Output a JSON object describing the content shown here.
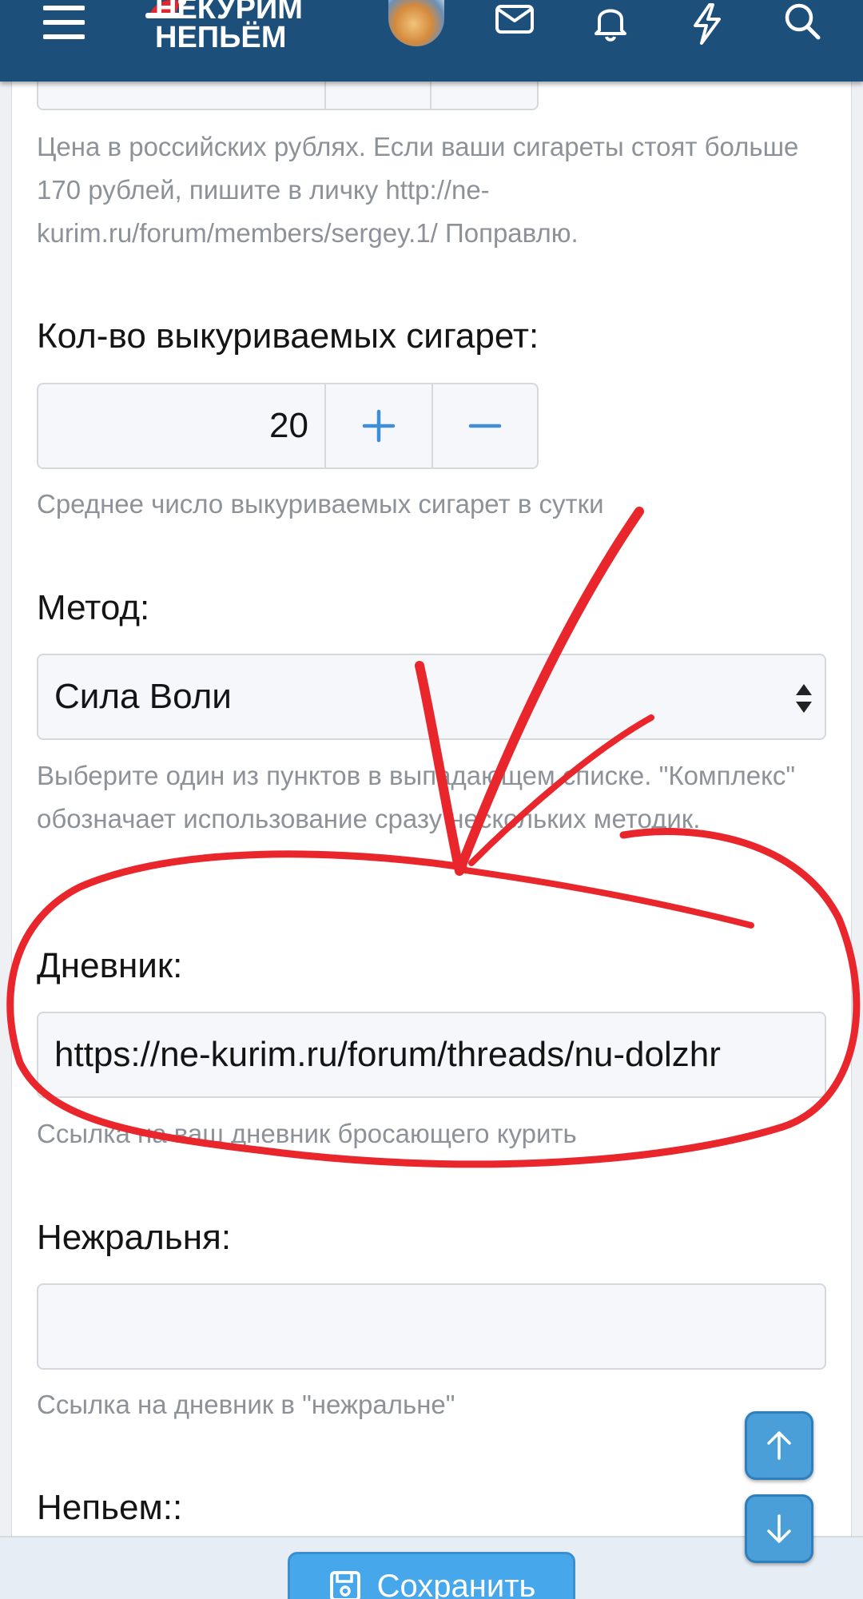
{
  "header": {
    "logo_line1": "НЕКУРИМ",
    "logo_line2": "НЕПЬЁМ",
    "icons": [
      "menu-icon",
      "mail-icon",
      "bell-icon",
      "bolt-icon",
      "search-icon"
    ],
    "brand_color": "#1d4f7b"
  },
  "form": {
    "price": {
      "hint": "Цена в российских рублях. Если ваши сигареты стоят больше 170 рублей, пишите в личку http://ne-kurim.ru/forum/members/sergey.1/ Поправлю."
    },
    "cigarettes": {
      "label": "Кол-во выкуриваемых сигарет:",
      "value": "20",
      "hint": "Среднее число выкуриваемых сигарет в сутки"
    },
    "method": {
      "label": "Метод:",
      "selected": "Сила Воли",
      "hint": "Выберите один из пунктов в выпадающем списке. \"Комплекс\" обозначает использование сразу нескольких методик."
    },
    "diary": {
      "label": "Дневник:",
      "value": "https://ne-kurim.ru/forum/threads/nu-dolzhr",
      "hint": "Ссылка на ваш дневник бросающего курить"
    },
    "nezhralnya": {
      "label": "Нежральня:",
      "value": "",
      "hint": "Ссылка на дневник в \"нежральне\""
    },
    "nepyem": {
      "label": "Непьем::"
    }
  },
  "footer": {
    "save_label": "Сохранить",
    "accent_color": "#47a7eb"
  },
  "annotation": {
    "color": "#e8262b",
    "marks": [
      "checkmark",
      "circle-around-diary-field"
    ]
  }
}
